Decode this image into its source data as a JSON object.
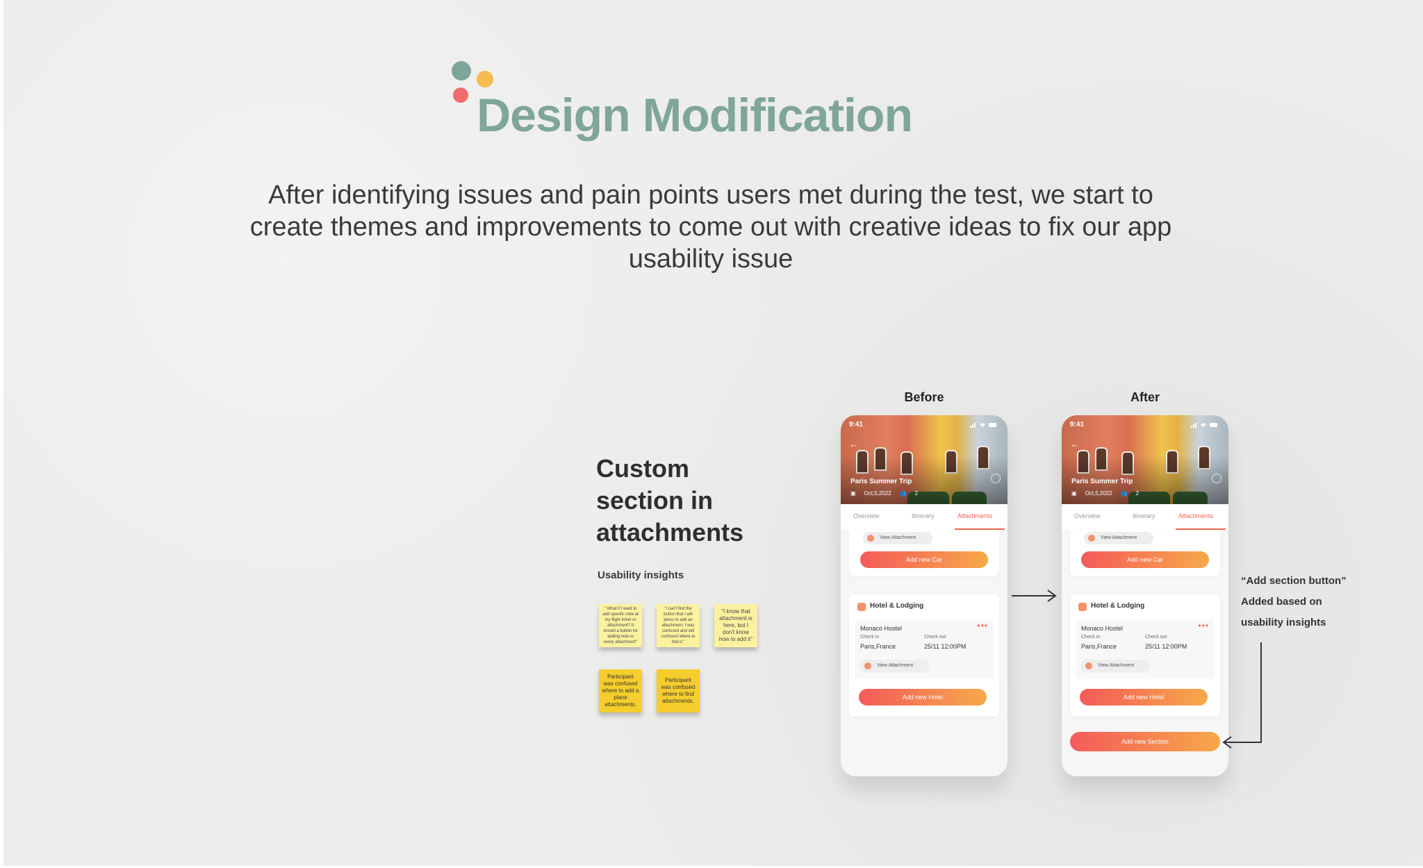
{
  "header": {
    "title": "Design Modification",
    "intro": "After identifying issues and pain points users met during the test, we start to create themes and improvements to come out with creative ideas to fix our app usability issue"
  },
  "section": {
    "heading": "Custom section in attachments",
    "insights_label": "Usability insights",
    "notes": [
      "\" What if I want to add specific note at my flight ticket or attachment? It should a button for adding note to every attachment\"",
      "\"I can't find the button that I will press to add an attachment. I was confused and still confused where to find it.\"",
      "\"I know that attachment is here, but I don't know how to add it\"",
      "Participant was confused where to add a plane attachments.",
      "Participant was confused where to find attachments."
    ]
  },
  "columns": {
    "before": "Before",
    "after": "After"
  },
  "phone": {
    "time": "9:41",
    "trip_title": "Paris Summer Trip",
    "date": "Oct,5,2022",
    "travelers": "2",
    "tabs": [
      "Overview",
      "Itinerary",
      "Attachments"
    ],
    "view_attachment": "View Attachment",
    "add_car": "Add new Car",
    "hotel_section": "Hotel & Lodging",
    "hotel_name": "Monaco Hostel",
    "check_in_label": "Check in",
    "check_out_label": "Check out",
    "check_in_value": "Paris,France",
    "check_out_value": "25/11  12:00PM",
    "add_hotel": "Add new Hotel",
    "add_section": "Add new Section"
  },
  "annotation": {
    "line1": "“Add section button”",
    "line2": "Added based on",
    "line3": "usability insights"
  },
  "colors": {
    "accent_teal": "#80a59b",
    "accent_yellow": "#f4bd4f",
    "accent_red": "#ef6c6c",
    "button_start": "#f55a5a",
    "button_end": "#f6a94a"
  }
}
